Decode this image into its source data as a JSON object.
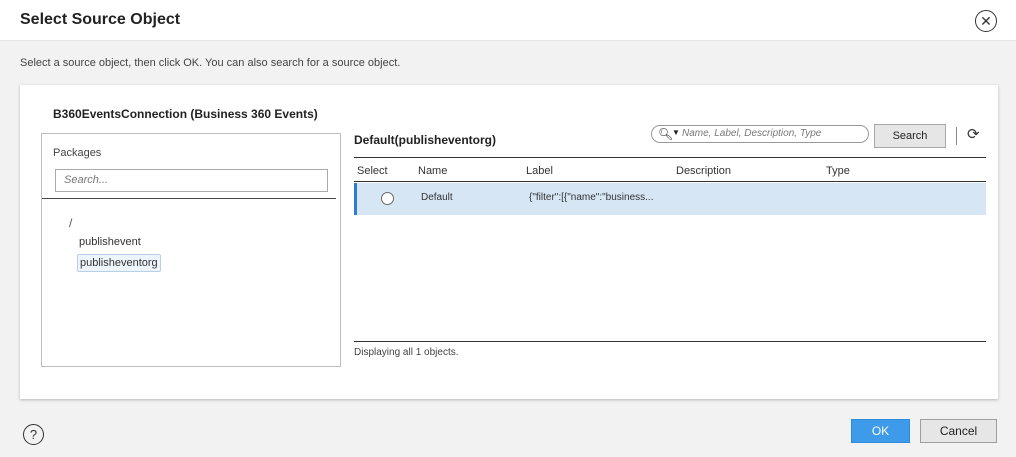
{
  "dialog": {
    "title": "Select Source Object",
    "instructions": "Select a source object, then click OK. You can also search for a source object."
  },
  "connection": {
    "title": "B360EventsConnection (Business 360 Events)"
  },
  "packages": {
    "label": "Packages",
    "search_placeholder": "Search...",
    "root": "/",
    "items": [
      "publishevent",
      "publisheventorg"
    ],
    "selected": "publisheventorg"
  },
  "objects": {
    "title": "Default(publisheventorg)",
    "search_placeholder": "Name, Label, Description, Type",
    "search_button": "Search",
    "columns": [
      "Select",
      "Name",
      "Label",
      "Description",
      "Type"
    ],
    "rows": [
      {
        "name": "Default",
        "label": "{\"filter\":[{\"name\":\"business...",
        "description": "",
        "type": ""
      }
    ],
    "status": "Displaying all 1 objects."
  },
  "footer": {
    "ok_label": "OK",
    "cancel_label": "Cancel"
  },
  "icons": {
    "close": "close-icon",
    "search": "search-icon",
    "refresh": "refresh-icon",
    "help": "help-icon"
  },
  "colors": {
    "accent": "#3d9be9",
    "selected_row": "#d6e6f5",
    "selected_row_marker": "#2e7cd5"
  }
}
